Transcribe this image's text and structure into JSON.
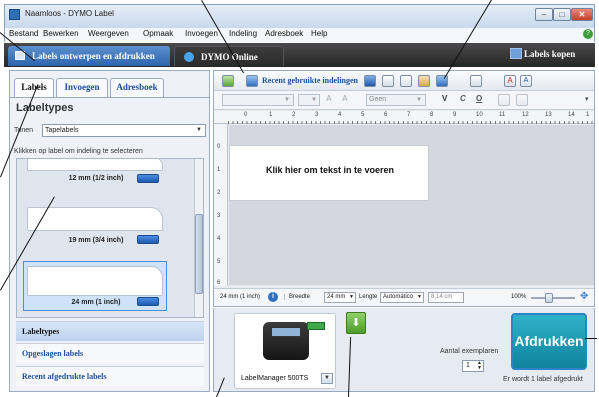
{
  "window": {
    "title": "Naamloos - DYMO Label"
  },
  "menu": [
    "Bestand",
    "Bewerken",
    "Weergeven",
    "Opmaak",
    "Invoegen",
    "Indeling",
    "Adresboek",
    "Help"
  ],
  "nav": {
    "design_tab": "Labels ontwerpen en afdrukken",
    "online_tab": "DYMO Online",
    "buy_labels": "Labels kopen"
  },
  "left": {
    "tabs": [
      "Labels",
      "Invoegen",
      "Adresboek"
    ],
    "heading": "Labeltypes",
    "show_label": "Tonen",
    "show_value": "Tapelabels",
    "instruction": "Klikken op label om indeling te selecteren",
    "tapes": [
      "12 mm (1/2 inch)",
      "19 mm (3/4 inch)",
      "24 mm (1 inch)"
    ],
    "sections": [
      "Labeltypes",
      "Opgeslagen labels",
      "Recent afgedrukte labels"
    ]
  },
  "editor": {
    "recent_layouts": "Recent gebruikte indelingen",
    "font_none": "Geen",
    "ruler": [
      "0",
      "1",
      "2",
      "3",
      "4",
      "5",
      "6",
      "7",
      "8",
      "9",
      "10",
      "11",
      "12",
      "13",
      "14",
      "1"
    ],
    "vruler": [
      "0",
      "1",
      "2",
      "3",
      "4",
      "5",
      "6"
    ],
    "placeholder": "Klik hier om tekst in te voeren",
    "status": {
      "tape": "24 mm (1 inch)",
      "width_label": "Breedte",
      "width_value": "24 mm",
      "length_label": "Lengte",
      "length_value": "Automático",
      "length_cm": "8,14 cm",
      "zoom": "100%"
    }
  },
  "print": {
    "printer": "LabelManager 500TS",
    "copies_label": "Aantal exemplaren",
    "copies_value": "1",
    "button": "Afdrukken",
    "status": "Er wordt 1 label afgedrukt"
  },
  "colors": {
    "accent": "#2d64ad",
    "print_button": "#1a9ab5",
    "nav_dark": "#2b2b2b"
  }
}
